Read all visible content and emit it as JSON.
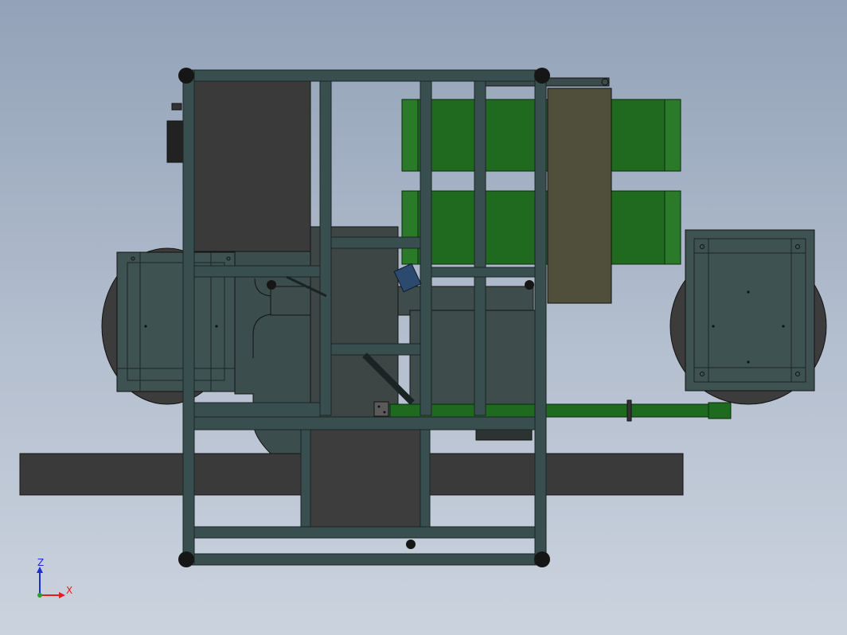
{
  "triad": {
    "z_label": "Z",
    "x_label": "X",
    "z_color": "#1a2fd0",
    "x_color": "#e0201a"
  },
  "colors": {
    "frame": "#394f4f",
    "frame_outline": "#1b2424",
    "dark_panel": "#3a3a3a",
    "tank": "#1f6a1f",
    "tank_outline": "#0c2a0c",
    "olive_panel": "#4f4f3c",
    "wheel": "#3c3c3c",
    "wheel_cover": "#3f5252",
    "arm": "#1e6a1e"
  },
  "icons": {
    "triad": "axis-triad-icon"
  }
}
